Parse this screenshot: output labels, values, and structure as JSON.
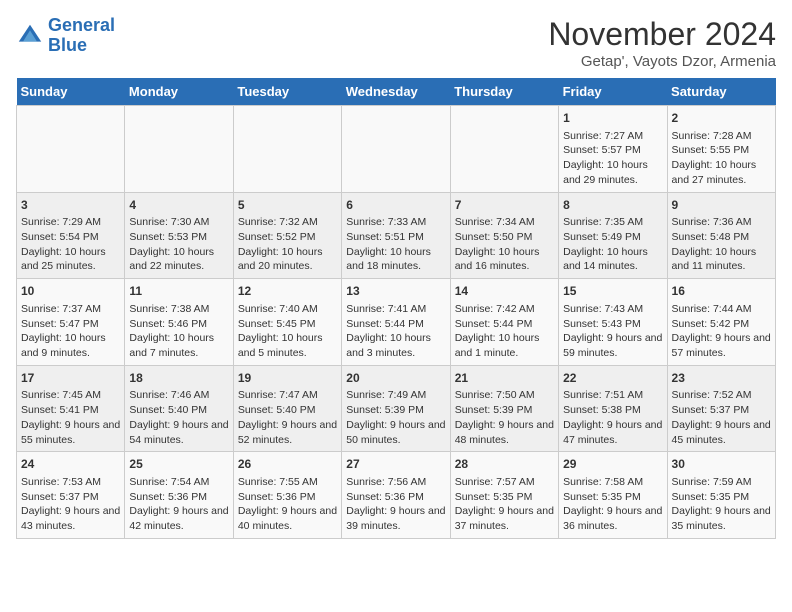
{
  "logo": {
    "line1": "General",
    "line2": "Blue"
  },
  "title": "November 2024",
  "subtitle": "Getap', Vayots Dzor, Armenia",
  "weekdays": [
    "Sunday",
    "Monday",
    "Tuesday",
    "Wednesday",
    "Thursday",
    "Friday",
    "Saturday"
  ],
  "weeks": [
    [
      {
        "day": "",
        "info": ""
      },
      {
        "day": "",
        "info": ""
      },
      {
        "day": "",
        "info": ""
      },
      {
        "day": "",
        "info": ""
      },
      {
        "day": "",
        "info": ""
      },
      {
        "day": "1",
        "info": "Sunrise: 7:27 AM\nSunset: 5:57 PM\nDaylight: 10 hours and 29 minutes."
      },
      {
        "day": "2",
        "info": "Sunrise: 7:28 AM\nSunset: 5:55 PM\nDaylight: 10 hours and 27 minutes."
      }
    ],
    [
      {
        "day": "3",
        "info": "Sunrise: 7:29 AM\nSunset: 5:54 PM\nDaylight: 10 hours and 25 minutes."
      },
      {
        "day": "4",
        "info": "Sunrise: 7:30 AM\nSunset: 5:53 PM\nDaylight: 10 hours and 22 minutes."
      },
      {
        "day": "5",
        "info": "Sunrise: 7:32 AM\nSunset: 5:52 PM\nDaylight: 10 hours and 20 minutes."
      },
      {
        "day": "6",
        "info": "Sunrise: 7:33 AM\nSunset: 5:51 PM\nDaylight: 10 hours and 18 minutes."
      },
      {
        "day": "7",
        "info": "Sunrise: 7:34 AM\nSunset: 5:50 PM\nDaylight: 10 hours and 16 minutes."
      },
      {
        "day": "8",
        "info": "Sunrise: 7:35 AM\nSunset: 5:49 PM\nDaylight: 10 hours and 14 minutes."
      },
      {
        "day": "9",
        "info": "Sunrise: 7:36 AM\nSunset: 5:48 PM\nDaylight: 10 hours and 11 minutes."
      }
    ],
    [
      {
        "day": "10",
        "info": "Sunrise: 7:37 AM\nSunset: 5:47 PM\nDaylight: 10 hours and 9 minutes."
      },
      {
        "day": "11",
        "info": "Sunrise: 7:38 AM\nSunset: 5:46 PM\nDaylight: 10 hours and 7 minutes."
      },
      {
        "day": "12",
        "info": "Sunrise: 7:40 AM\nSunset: 5:45 PM\nDaylight: 10 hours and 5 minutes."
      },
      {
        "day": "13",
        "info": "Sunrise: 7:41 AM\nSunset: 5:44 PM\nDaylight: 10 hours and 3 minutes."
      },
      {
        "day": "14",
        "info": "Sunrise: 7:42 AM\nSunset: 5:44 PM\nDaylight: 10 hours and 1 minute."
      },
      {
        "day": "15",
        "info": "Sunrise: 7:43 AM\nSunset: 5:43 PM\nDaylight: 9 hours and 59 minutes."
      },
      {
        "day": "16",
        "info": "Sunrise: 7:44 AM\nSunset: 5:42 PM\nDaylight: 9 hours and 57 minutes."
      }
    ],
    [
      {
        "day": "17",
        "info": "Sunrise: 7:45 AM\nSunset: 5:41 PM\nDaylight: 9 hours and 55 minutes."
      },
      {
        "day": "18",
        "info": "Sunrise: 7:46 AM\nSunset: 5:40 PM\nDaylight: 9 hours and 54 minutes."
      },
      {
        "day": "19",
        "info": "Sunrise: 7:47 AM\nSunset: 5:40 PM\nDaylight: 9 hours and 52 minutes."
      },
      {
        "day": "20",
        "info": "Sunrise: 7:49 AM\nSunset: 5:39 PM\nDaylight: 9 hours and 50 minutes."
      },
      {
        "day": "21",
        "info": "Sunrise: 7:50 AM\nSunset: 5:39 PM\nDaylight: 9 hours and 48 minutes."
      },
      {
        "day": "22",
        "info": "Sunrise: 7:51 AM\nSunset: 5:38 PM\nDaylight: 9 hours and 47 minutes."
      },
      {
        "day": "23",
        "info": "Sunrise: 7:52 AM\nSunset: 5:37 PM\nDaylight: 9 hours and 45 minutes."
      }
    ],
    [
      {
        "day": "24",
        "info": "Sunrise: 7:53 AM\nSunset: 5:37 PM\nDaylight: 9 hours and 43 minutes."
      },
      {
        "day": "25",
        "info": "Sunrise: 7:54 AM\nSunset: 5:36 PM\nDaylight: 9 hours and 42 minutes."
      },
      {
        "day": "26",
        "info": "Sunrise: 7:55 AM\nSunset: 5:36 PM\nDaylight: 9 hours and 40 minutes."
      },
      {
        "day": "27",
        "info": "Sunrise: 7:56 AM\nSunset: 5:36 PM\nDaylight: 9 hours and 39 minutes."
      },
      {
        "day": "28",
        "info": "Sunrise: 7:57 AM\nSunset: 5:35 PM\nDaylight: 9 hours and 37 minutes."
      },
      {
        "day": "29",
        "info": "Sunrise: 7:58 AM\nSunset: 5:35 PM\nDaylight: 9 hours and 36 minutes."
      },
      {
        "day": "30",
        "info": "Sunrise: 7:59 AM\nSunset: 5:35 PM\nDaylight: 9 hours and 35 minutes."
      }
    ]
  ]
}
